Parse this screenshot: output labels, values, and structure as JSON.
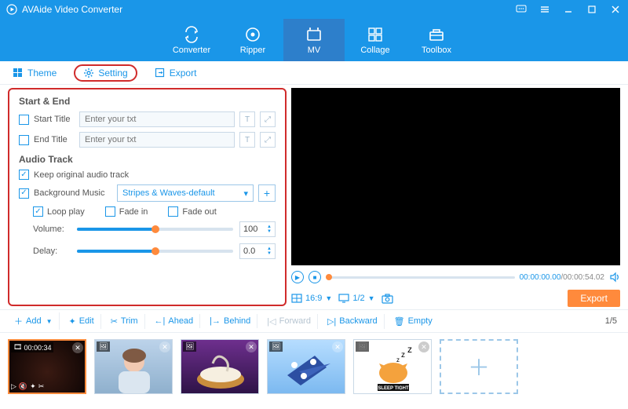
{
  "app": {
    "title": "AVAide Video Converter"
  },
  "nav": {
    "converter": "Converter",
    "ripper": "Ripper",
    "mv": "MV",
    "collage": "Collage",
    "toolbox": "Toolbox"
  },
  "tabs": {
    "theme": "Theme",
    "setting": "Setting",
    "export": "Export"
  },
  "settings": {
    "start_end": {
      "heading": "Start & End",
      "start_label": "Start Title",
      "end_label": "End Title",
      "placeholder": "Enter your txt"
    },
    "audio": {
      "heading": "Audio Track",
      "keep_original": "Keep original audio track",
      "bg_music": "Background Music",
      "bg_music_value": "Stripes & Waves-default",
      "loop": "Loop play",
      "fade_in": "Fade in",
      "fade_out": "Fade out",
      "volume_label": "Volume:",
      "volume_value": "100",
      "delay_label": "Delay:",
      "delay_value": "0.0"
    }
  },
  "preview": {
    "current_time": "00:00:00.00",
    "duration": "/00:00:54.02",
    "aspect": "16:9",
    "display": "1/2",
    "export": "Export"
  },
  "toolbar": {
    "add": "Add",
    "edit": "Edit",
    "trim": "Trim",
    "ahead": "Ahead",
    "behind": "Behind",
    "forward": "Forward",
    "backward": "Backward",
    "empty": "Empty",
    "page": "1/5"
  },
  "thumbs": {
    "first_duration": "00:00:34"
  }
}
